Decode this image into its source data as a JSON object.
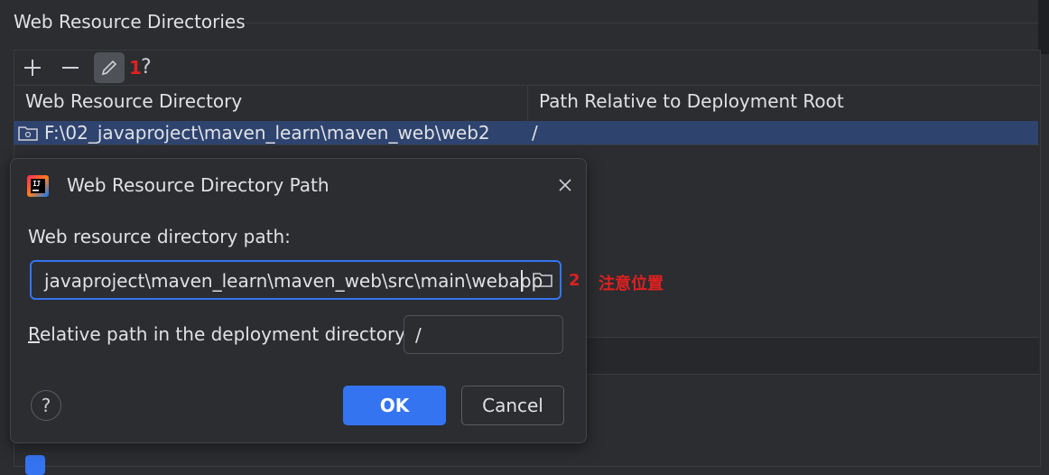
{
  "section": {
    "title": "Web Resource Directories"
  },
  "toolbar": {
    "add": "+",
    "remove": "—",
    "annotation": "1",
    "help": "?"
  },
  "table": {
    "headers": [
      "Web Resource Directory",
      "Path Relative to Deployment Root"
    ],
    "rows": [
      {
        "directory": "F:\\02_javaproject\\maven_learn\\maven_web\\web2",
        "relative": "/"
      }
    ]
  },
  "dialog": {
    "title": "Web Resource Directory Path",
    "close": "×",
    "path_label": "Web resource directory path:",
    "path_value": "javaproject\\maven_learn\\maven_web\\src\\main\\webapp",
    "annotation": "2",
    "annotation_note": "注意位置",
    "relative_label_first": "R",
    "relative_label_rest": "elative path in the deployment directory:",
    "relative_value": "/",
    "help": "?",
    "ok": "OK",
    "cancel": "Cancel"
  },
  "colors": {
    "accent": "#3574f0",
    "selection": "#2e436e",
    "annotation": "#e02020",
    "background": "#2b2d30"
  }
}
